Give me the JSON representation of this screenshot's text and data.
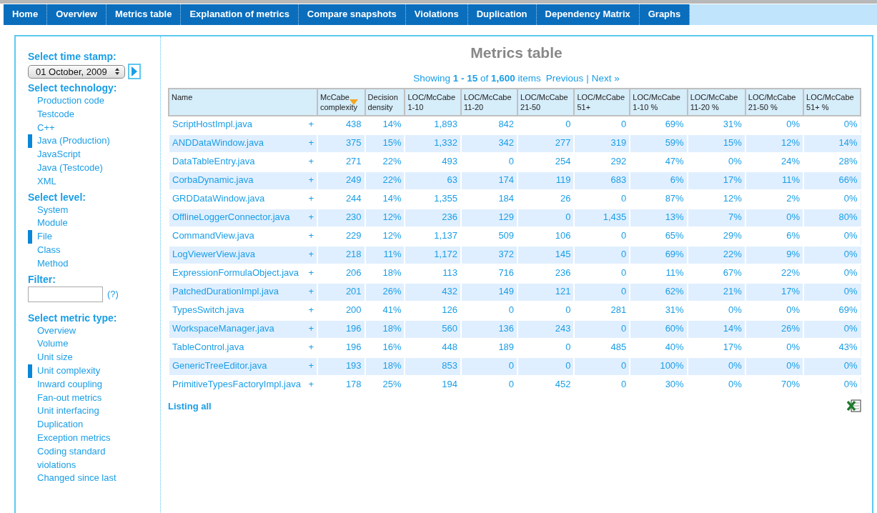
{
  "nav": [
    {
      "label": "Home"
    },
    {
      "label": "Overview"
    },
    {
      "label": "Metrics table"
    },
    {
      "label": "Explanation of metrics"
    },
    {
      "label": "Compare snapshots"
    },
    {
      "label": "Violations"
    },
    {
      "label": "Duplication"
    },
    {
      "label": "Dependency Matrix"
    },
    {
      "label": "Graphs"
    }
  ],
  "sidebar": {
    "time_stamp": {
      "heading": "Select time stamp:",
      "value": "01 October, 2009"
    },
    "technology": {
      "heading": "Select technology:",
      "items": [
        {
          "label": "Production code",
          "selected": false
        },
        {
          "label": "Testcode",
          "selected": false
        },
        {
          "label": "C++",
          "selected": false
        },
        {
          "label": "Java (Production)",
          "selected": true
        },
        {
          "label": "JavaScript",
          "selected": false
        },
        {
          "label": "Java (Testcode)",
          "selected": false
        },
        {
          "label": "XML",
          "selected": false
        }
      ]
    },
    "level": {
      "heading": "Select level:",
      "items": [
        {
          "label": "System",
          "selected": false
        },
        {
          "label": "Module",
          "selected": false
        },
        {
          "label": "File",
          "selected": true
        },
        {
          "label": "Class",
          "selected": false
        },
        {
          "label": "Method",
          "selected": false
        }
      ]
    },
    "filter": {
      "heading": "Filter:",
      "help": "(?)"
    },
    "metric_type": {
      "heading": "Select metric type:",
      "items": [
        {
          "label": "Overview",
          "selected": false
        },
        {
          "label": "Volume",
          "selected": false
        },
        {
          "label": "Unit size",
          "selected": false
        },
        {
          "label": "Unit complexity",
          "selected": true
        },
        {
          "label": "Inward coupling",
          "selected": false
        },
        {
          "label": "Fan-out metrics",
          "selected": false
        },
        {
          "label": "Unit interfacing",
          "selected": false
        },
        {
          "label": "Duplication",
          "selected": false
        },
        {
          "label": "Exception metrics",
          "selected": false
        },
        {
          "label": "Coding standard violations",
          "selected": false
        },
        {
          "label": "Changed since last",
          "selected": false
        }
      ]
    }
  },
  "main": {
    "title": "Metrics table",
    "paging": {
      "showing": "Showing **1 - 15** of **1,600** items",
      "previous": "Previous",
      "separator": "|",
      "next": "Next »"
    },
    "table": {
      "columns": [
        {
          "label": "Name",
          "sorted": false
        },
        {
          "label": "McCabe complexity",
          "sorted": true
        },
        {
          "label": "Decision density",
          "sorted": false
        },
        {
          "label": "LOC/McCabe 1-10",
          "sorted": false
        },
        {
          "label": "LOC/McCabe 11-20",
          "sorted": false
        },
        {
          "label": "LOC/McCabe 21-50",
          "sorted": false
        },
        {
          "label": "LOC/McCabe 51+",
          "sorted": false
        },
        {
          "label": "LOC/McCabe 1-10 %",
          "sorted": false
        },
        {
          "label": "LOC/McCabe 11-20 %",
          "sorted": false
        },
        {
          "label": "LOC/McCabe 21-50 %",
          "sorted": false
        },
        {
          "label": "LOC/McCabe 51+ %",
          "sorted": false
        }
      ],
      "rows": [
        {
          "name": "ScriptHostImpl.java",
          "expand": "+",
          "values": [
            "438",
            "14%",
            "1,893",
            "842",
            "0",
            "0",
            "69%",
            "31%",
            "0%",
            "0%"
          ]
        },
        {
          "name": "ANDDataWindow.java",
          "expand": "+",
          "values": [
            "375",
            "15%",
            "1,332",
            "342",
            "277",
            "319",
            "59%",
            "15%",
            "12%",
            "14%"
          ]
        },
        {
          "name": "DataTableEntry.java",
          "expand": "+",
          "values": [
            "271",
            "22%",
            "493",
            "0",
            "254",
            "292",
            "47%",
            "0%",
            "24%",
            "28%"
          ]
        },
        {
          "name": "CorbaDynamic.java",
          "expand": "+",
          "values": [
            "249",
            "22%",
            "63",
            "174",
            "119",
            "683",
            "6%",
            "17%",
            "11%",
            "66%"
          ]
        },
        {
          "name": "GRDDataWindow.java",
          "expand": "+",
          "values": [
            "244",
            "14%",
            "1,355",
            "184",
            "26",
            "0",
            "87%",
            "12%",
            "2%",
            "0%"
          ]
        },
        {
          "name": "OfflineLoggerConnector.java",
          "expand": "+",
          "values": [
            "230",
            "12%",
            "236",
            "129",
            "0",
            "1,435",
            "13%",
            "7%",
            "0%",
            "80%"
          ]
        },
        {
          "name": "CommandView.java",
          "expand": "+",
          "values": [
            "229",
            "12%",
            "1,137",
            "509",
            "106",
            "0",
            "65%",
            "29%",
            "6%",
            "0%"
          ]
        },
        {
          "name": "LogViewerView.java",
          "expand": "+",
          "values": [
            "218",
            "11%",
            "1,172",
            "372",
            "145",
            "0",
            "69%",
            "22%",
            "9%",
            "0%"
          ]
        },
        {
          "name": "ExpressionFormulaObject.java",
          "expand": "+",
          "values": [
            "206",
            "18%",
            "113",
            "716",
            "236",
            "0",
            "11%",
            "67%",
            "22%",
            "0%"
          ]
        },
        {
          "name": "PatchedDurationImpl.java",
          "expand": "+",
          "values": [
            "201",
            "26%",
            "432",
            "149",
            "121",
            "0",
            "62%",
            "21%",
            "17%",
            "0%"
          ]
        },
        {
          "name": "TypesSwitch.java",
          "expand": "+",
          "values": [
            "200",
            "41%",
            "126",
            "0",
            "0",
            "281",
            "31%",
            "0%",
            "0%",
            "69%"
          ]
        },
        {
          "name": "WorkspaceManager.java",
          "expand": "+",
          "values": [
            "196",
            "18%",
            "560",
            "136",
            "243",
            "0",
            "60%",
            "14%",
            "26%",
            "0%"
          ]
        },
        {
          "name": "TableControl.java",
          "expand": "+",
          "values": [
            "196",
            "16%",
            "448",
            "189",
            "0",
            "485",
            "40%",
            "17%",
            "0%",
            "43%"
          ]
        },
        {
          "name": "GenericTreeEditor.java",
          "expand": "+",
          "values": [
            "193",
            "18%",
            "853",
            "0",
            "0",
            "0",
            "100%",
            "0%",
            "0%",
            "0%"
          ]
        },
        {
          "name": "PrimitiveTypesFactoryImpl.java",
          "expand": "+",
          "values": [
            "178",
            "25%",
            "194",
            "0",
            "452",
            "0",
            "30%",
            "0%",
            "70%",
            "0%"
          ]
        }
      ]
    },
    "listing_all": "Listing all"
  }
}
